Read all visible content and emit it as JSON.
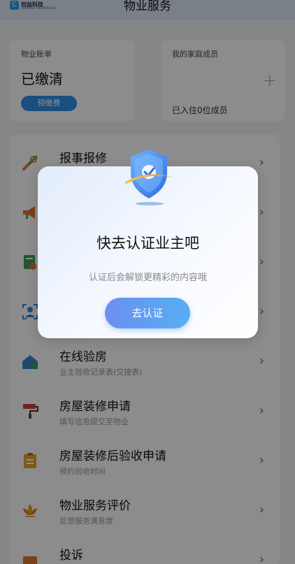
{
  "header": {
    "logo_text": "创益科技",
    "logo_sub": "CHUANGYI TECHNOLOGY",
    "title": "物业服务"
  },
  "bill": {
    "label": "物业账单",
    "status": "已缴清",
    "prepay_label": "预缴费"
  },
  "family": {
    "label": "我的家庭成员",
    "count_text": "已入住0位成员"
  },
  "services": [
    {
      "title": "报事报修",
      "subtitle": "",
      "icon": "tools-icon"
    },
    {
      "title": "",
      "subtitle": "",
      "icon": "megaphone-icon"
    },
    {
      "title": "",
      "subtitle": "",
      "icon": "document-check-icon"
    },
    {
      "title": "",
      "subtitle": "",
      "icon": "person-scan-icon"
    },
    {
      "title": "在线验房",
      "subtitle": "业主验收记录表(交接表)",
      "icon": "house-check-icon"
    },
    {
      "title": "房屋装修申请",
      "subtitle": "填写信息提交至物业",
      "icon": "paint-roller-icon"
    },
    {
      "title": "房屋装修后验收申请",
      "subtitle": "预约验收时间",
      "icon": "clipboard-icon"
    },
    {
      "title": "物业服务评价",
      "subtitle": "反馈服务满意度",
      "icon": "lotus-icon"
    },
    {
      "title": "投诉",
      "subtitle": "",
      "icon": "complaint-icon"
    }
  ],
  "modal": {
    "title": "快去认证业主吧",
    "description": "认证后会解锁更精彩的内容哦",
    "button_label": "去认证"
  },
  "colors": {
    "accent": "#2e8ee8",
    "icon_orange": "#e0742f",
    "icon_green": "#3aa05a"
  }
}
